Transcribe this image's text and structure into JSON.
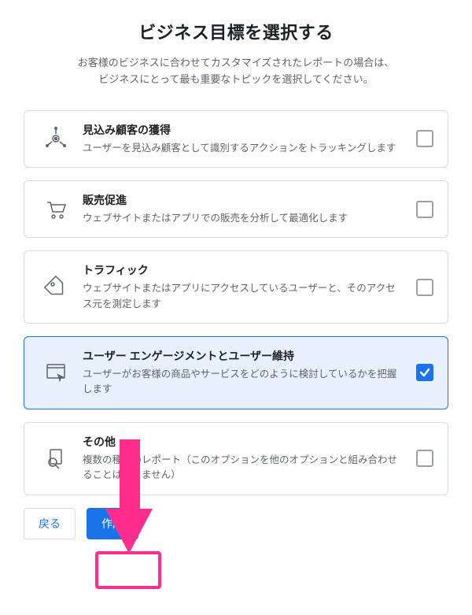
{
  "header": {
    "title": "ビジネス目標を選択する",
    "subtitle_line1": "お客様のビジネスに合わせてカスタマイズされたレポートの場合は、",
    "subtitle_line2": "ビジネスにとって最も重要なトピックを選択してください。"
  },
  "options": [
    {
      "id": "leads",
      "title": "見込み顧客の獲得",
      "desc": "ユーザーを見込み顧客として識別するアクションをトラッキングします",
      "checked": false
    },
    {
      "id": "sales",
      "title": "販売促進",
      "desc": "ウェブサイトまたはアプリでの販売を分析して最適化します",
      "checked": false
    },
    {
      "id": "traffic",
      "title": "トラフィック",
      "desc": "ウェブサイトまたはアプリにアクセスしているユーザーと、そのアクセス元を測定します",
      "checked": false
    },
    {
      "id": "engagement",
      "title": "ユーザー エンゲージメントとユーザー維持",
      "desc": "ユーザーがお客様の商品やサービスをどのように検討しているかを把握します",
      "checked": true
    },
    {
      "id": "other",
      "title": "その他",
      "desc": "複数の種類のレポート（このオプションを他のオプションと組み合わせることはできません）",
      "checked": false
    }
  ],
  "footer": {
    "back_label": "戻る",
    "create_label": "作成"
  },
  "annotation": {
    "arrow_color": "#ff2d8e",
    "highlight_color": "#ff2d8e"
  }
}
